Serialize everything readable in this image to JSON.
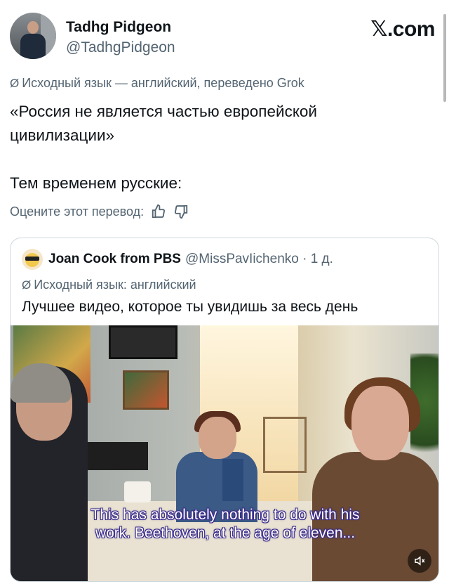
{
  "author": {
    "name": "Tadhg Pidgeon",
    "handle": "@TadhgPidgeon"
  },
  "brand": "𝕏.com",
  "translation_note": "Исходный язык — английский, переведено Grok",
  "tweet": {
    "line1": "«Россия не является частью европейской",
    "line2": "цивилизации»",
    "line3": "Тем временем русские:"
  },
  "rate_prompt": "Оцените этот перевод:",
  "icons": {
    "translate": "translate-icon",
    "thumbs_up": "thumbs-up-icon",
    "thumbs_down": "thumbs-down-icon",
    "mute": "speaker-muted-icon"
  },
  "quote": {
    "name": "Joan Cook from PBS",
    "handle_time": "@MissPavIichenko · 1 д.",
    "note": "Исходный язык: английский",
    "text": "Лучшее видео, которое ты увидишь за весь день",
    "subtitle_line1": "This has absolutely nothing to do with his",
    "subtitle_line2": "work. Beethoven, at the age of eleven..."
  },
  "colors": {
    "text_primary": "#0f1419",
    "text_secondary": "#536471",
    "border": "#cfd9de",
    "subtitle_outline": "#3a2a8a"
  }
}
